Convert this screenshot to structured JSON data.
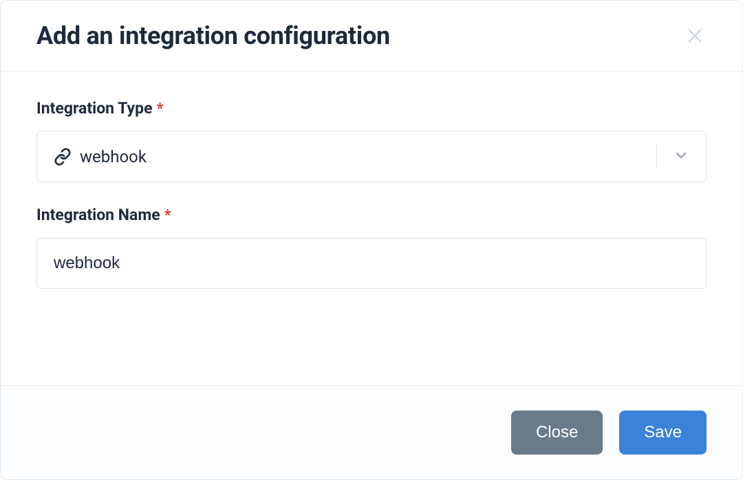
{
  "modal": {
    "title": "Add an integration configuration"
  },
  "fields": {
    "type": {
      "label": "Integration Type",
      "required_asterisk": "*",
      "selected": "webhook"
    },
    "name": {
      "label": "Integration Name",
      "required_asterisk": "*",
      "value": "webhook"
    }
  },
  "footer": {
    "close": "Close",
    "save": "Save"
  }
}
